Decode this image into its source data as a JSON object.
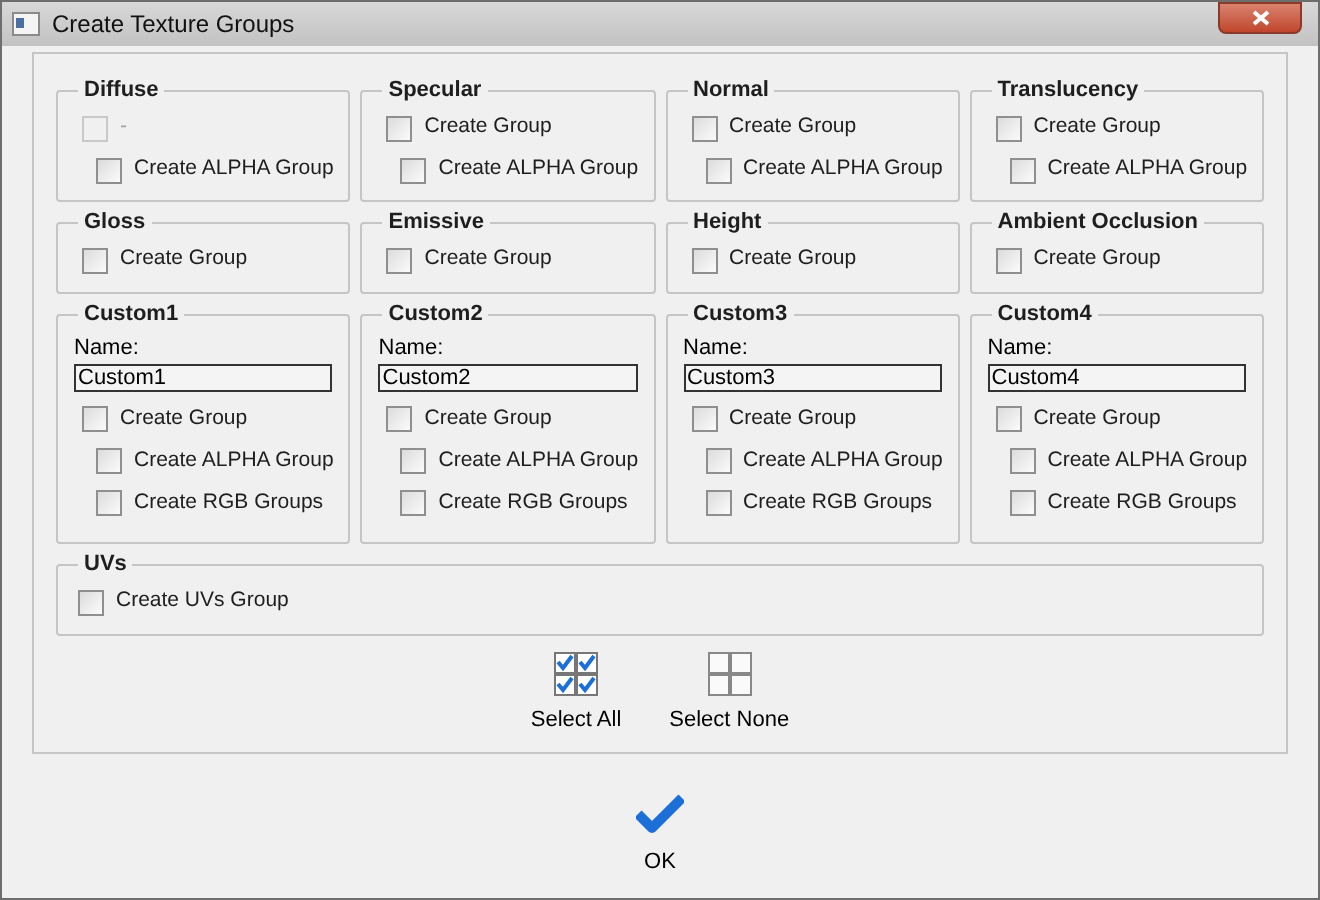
{
  "window": {
    "title": "Create Texture Groups"
  },
  "groups": [
    {
      "title": "Diffuse",
      "options": [
        {
          "label": "-",
          "checked": false,
          "disabled": true,
          "children": [
            {
              "label": "Create ALPHA Group",
              "checked": false,
              "disabled": false
            }
          ]
        }
      ]
    },
    {
      "title": "Specular",
      "options": [
        {
          "label": "Create Group",
          "checked": false,
          "disabled": false,
          "children": [
            {
              "label": "Create ALPHA Group",
              "checked": false,
              "disabled": false
            }
          ]
        }
      ]
    },
    {
      "title": "Normal",
      "options": [
        {
          "label": "Create Group",
          "checked": false,
          "disabled": false,
          "children": [
            {
              "label": "Create ALPHA Group",
              "checked": false,
              "disabled": false
            }
          ]
        }
      ]
    },
    {
      "title": "Translucency",
      "options": [
        {
          "label": "Create Group",
          "checked": false,
          "disabled": false,
          "children": [
            {
              "label": "Create ALPHA Group",
              "checked": false,
              "disabled": false
            }
          ]
        }
      ]
    },
    {
      "title": "Gloss",
      "options": [
        {
          "label": "Create Group",
          "checked": false,
          "disabled": false
        }
      ]
    },
    {
      "title": "Emissive",
      "options": [
        {
          "label": "Create Group",
          "checked": false,
          "disabled": false
        }
      ]
    },
    {
      "title": "Height",
      "options": [
        {
          "label": "Create Group",
          "checked": false,
          "disabled": false
        }
      ]
    },
    {
      "title": "Ambient Occlusion",
      "options": [
        {
          "label": "Create Group",
          "checked": false,
          "disabled": false
        }
      ]
    },
    {
      "title": "Custom1",
      "name_label": "Name:",
      "name_value": "Custom1",
      "options": [
        {
          "label": "Create Group",
          "checked": false,
          "disabled": false,
          "children": [
            {
              "label": "Create ALPHA Group",
              "checked": false,
              "disabled": false
            },
            {
              "label": "Create RGB Groups",
              "checked": false,
              "disabled": false
            }
          ]
        }
      ]
    },
    {
      "title": "Custom2",
      "name_label": "Name:",
      "name_value": "Custom2",
      "options": [
        {
          "label": "Create Group",
          "checked": false,
          "disabled": false,
          "children": [
            {
              "label": "Create ALPHA Group",
              "checked": false,
              "disabled": false
            },
            {
              "label": "Create RGB Groups",
              "checked": false,
              "disabled": false
            }
          ]
        }
      ]
    },
    {
      "title": "Custom3",
      "name_label": "Name:",
      "name_value": "Custom3",
      "options": [
        {
          "label": "Create Group",
          "checked": false,
          "disabled": false,
          "children": [
            {
              "label": "Create ALPHA Group",
              "checked": false,
              "disabled": false
            },
            {
              "label": "Create RGB Groups",
              "checked": false,
              "disabled": false
            }
          ]
        }
      ]
    },
    {
      "title": "Custom4",
      "name_label": "Name:",
      "name_value": "Custom4",
      "options": [
        {
          "label": "Create Group",
          "checked": false,
          "disabled": false,
          "children": [
            {
              "label": "Create ALPHA Group",
              "checked": false,
              "disabled": false
            },
            {
              "label": "Create RGB Groups",
              "checked": false,
              "disabled": false
            }
          ]
        }
      ]
    }
  ],
  "uvs": {
    "title": "UVs",
    "options": [
      {
        "label": "Create UVs Group",
        "checked": false,
        "disabled": false
      }
    ]
  },
  "selection_buttons": [
    {
      "label": "Select All",
      "kind": "all"
    },
    {
      "label": "Select None",
      "kind": "none"
    }
  ],
  "ok_button": {
    "label": "OK"
  }
}
